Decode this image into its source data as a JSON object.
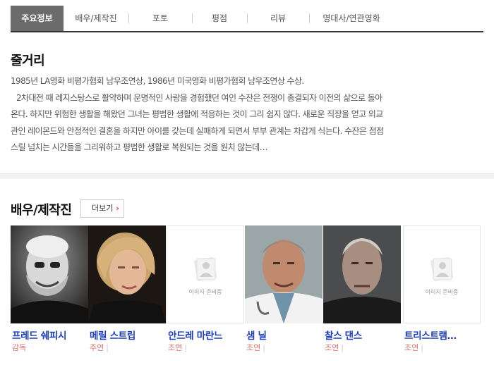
{
  "tabs": [
    "주요정보",
    "배우/제작진",
    "포토",
    "평점",
    "리뷰",
    "명대사/연관영화"
  ],
  "synopsis": {
    "title": "줄거리",
    "lines": [
      "1985년 LA영화 비평가협회 남우조연상, 1986년 미국영화 비평가협회 남우조연상 수상.",
      "2차대전 때 레지스탕스로 활약하며 운명적인 사랑을 경험했던 여인 수잔은 전쟁이 종결되자 이전의 삶으로 돌아",
      "온다. 하지만 위험한 생활을 해왔던 그녀는 평범한 생활에 적응하는 것이 그리 쉽지 않다. 새로운 직장을 얻고 외교",
      "관인 레이몬드와 안정적인 결혼을 하지만 아이를 갖는데 실패하게 되면서 부부 관계는 차갑게 식는다. 수잔은 점점",
      "스릴 넘치는 시간들을 그리워하고 평범한 생활로 복원되는 것을 원치 않는데…"
    ]
  },
  "cast": {
    "title": "배우/제작진",
    "more_label": "더보기",
    "placeholder_text": "이미지 준비중",
    "people": [
      {
        "name": "프레드 쉐피시",
        "role": "감독"
      },
      {
        "name": "메릴 스트립",
        "role": "주연"
      },
      {
        "name": "안드레 마란느",
        "role": "조연"
      },
      {
        "name": "샘 닐",
        "role": "조연"
      },
      {
        "name": "찰스 댄스",
        "role": "조연"
      },
      {
        "name": "트리스트램…",
        "role": "조연"
      }
    ]
  },
  "colors": {
    "name_link": "#1a3dbf",
    "role": "#e07070",
    "active_tab": "#6b6b6b",
    "accent": "#e61e2b"
  }
}
